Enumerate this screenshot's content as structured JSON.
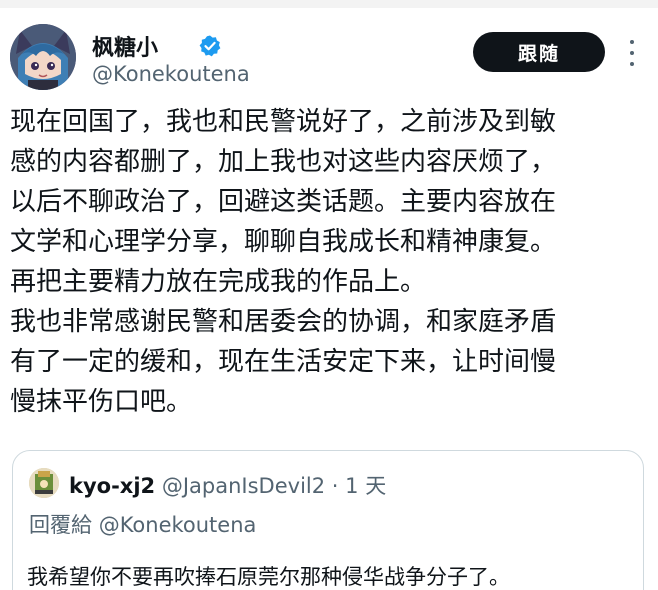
{
  "author": {
    "display_name": "枫糖小",
    "handle": "@Konekoutena",
    "avatar_icon": "anime-avatar"
  },
  "follow_button": {
    "label": "跟随"
  },
  "more_icon": "more-vertical-icon",
  "tweet": {
    "lines": [
      "现在回国了，我也和民警说好了，之前涉及到敏",
      "感的内容都删了，加上我也对这些内容厌烦了，",
      "以后不聊政治了，回避这类话题。主要内容放在",
      "文学和心理学分享，聊聊自我成长和精神康复。",
      "再把主要精力放在完成我的作品上。",
      "我也非常感谢民警和居委会的协调，和家庭矛盾",
      "有了一定的缓和，现在生活安定下来，让时间慢",
      "慢抹平伤口吧。"
    ]
  },
  "quote": {
    "author_name": "kyo-xj2",
    "author_handle": "@JapanIsDevil2",
    "separator": "·",
    "time": "1 天",
    "reply_label": "回覆給",
    "reply_to": "@Konekoutena",
    "text": "我希望你不要再吹捧石原莞尔那种侵华战争分子了。"
  },
  "colors": {
    "text_primary": "#0f1419",
    "text_secondary": "#536471",
    "button_bg": "#0f1419",
    "border": "#cfd9de"
  }
}
